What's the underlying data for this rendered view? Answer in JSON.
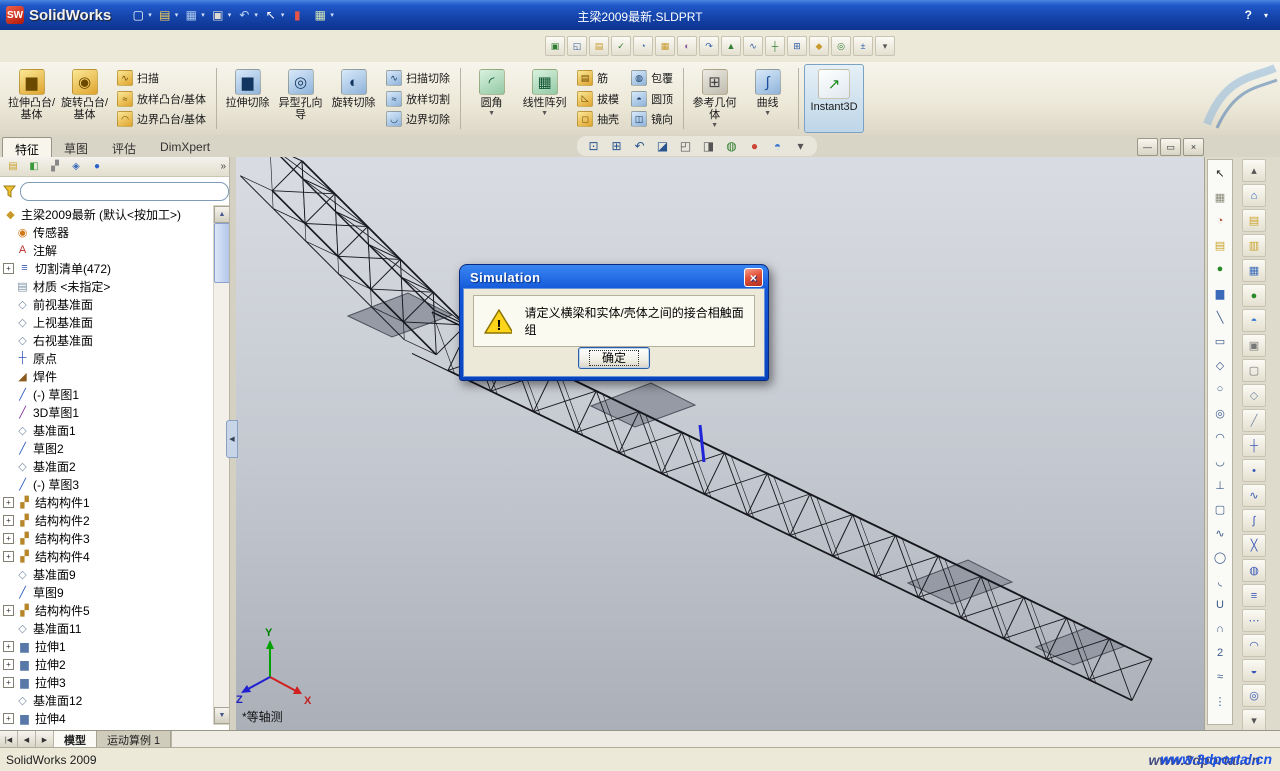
{
  "titlebar": {
    "app": "SolidWorks",
    "doc": "主梁2009最新.SLDPRT",
    "help": "?",
    "tools": [
      {
        "name": "new-document-icon",
        "caret": true
      },
      {
        "name": "open-document-icon",
        "caret": true
      },
      {
        "name": "save-icon",
        "caret": true
      },
      {
        "name": "print-icon",
        "caret": true
      },
      {
        "name": "undo-icon",
        "caret": true
      },
      {
        "name": "select-icon",
        "caret": true
      },
      {
        "name": "record-macro-icon",
        "caret": false
      },
      {
        "name": "options-icon",
        "caret": true
      }
    ]
  },
  "toolbar2": {
    "icons": [
      "screen-capture-icon",
      "3d-drawing-view-icon",
      "publish-edrawings-icon",
      "design-checker-icon",
      "task-scheduler-icon",
      "toolbox-icon",
      "photoworks-icon",
      "motion-manager-icon",
      "simulation-addin-icon",
      "flow-simulation-icon",
      "routing-icon",
      "circuitworks-icon",
      "featureworks-icon",
      "scanto3d-icon",
      "tolanalyst-icon",
      "addins-settings-icon"
    ]
  },
  "ribbon": {
    "buttons": [
      {
        "type": "big",
        "icon": "extrude-boss-icon",
        "label": "拉伸凸台/基体"
      },
      {
        "type": "big",
        "icon": "revolve-boss-icon",
        "label": "旋转凸台/基体"
      },
      {
        "type": "stack",
        "items": [
          {
            "icon": "sweep-icon",
            "label": "扫描"
          },
          {
            "icon": "loft-icon",
            "label": "放样凸台/基体"
          },
          {
            "icon": "boundary-boss-icon",
            "label": "边界凸台/基体"
          }
        ]
      },
      {
        "type": "sep"
      },
      {
        "type": "big",
        "icon": "extrude-cut-icon",
        "label": "拉伸切除"
      },
      {
        "type": "big",
        "icon": "hole-wizard-icon",
        "label": "异型孔向导"
      },
      {
        "type": "big",
        "icon": "revolve-cut-icon",
        "label": "旋转切除"
      },
      {
        "type": "stack",
        "items": [
          {
            "icon": "sweep-cut-icon",
            "label": "扫描切除"
          },
          {
            "icon": "loft-cut-icon",
            "label": "放样切割"
          },
          {
            "icon": "boundary-cut-icon",
            "label": "边界切除"
          }
        ]
      },
      {
        "type": "sep"
      },
      {
        "type": "big",
        "icon": "fillet-icon",
        "label": "圆角",
        "dropdown": true
      },
      {
        "type": "big",
        "icon": "linear-pattern-icon",
        "label": "线性阵列",
        "dropdown": true
      },
      {
        "type": "stack",
        "items": [
          {
            "icon": "rib-icon",
            "label": "筋"
          },
          {
            "icon": "draft-icon",
            "label": "拔模"
          },
          {
            "icon": "shell-icon",
            "label": "抽壳"
          }
        ]
      },
      {
        "type": "stack",
        "items": [
          {
            "icon": "wrap-icon",
            "label": "包覆"
          },
          {
            "icon": "dome-icon",
            "label": "圆顶"
          },
          {
            "icon": "mirror-icon",
            "label": "镜向"
          }
        ]
      },
      {
        "type": "sep"
      },
      {
        "type": "big",
        "icon": "reference-geometry-icon",
        "label": "参考几何体",
        "dropdown": true
      },
      {
        "type": "big",
        "icon": "curves-icon",
        "label": "曲线",
        "dropdown": true
      },
      {
        "type": "sep"
      },
      {
        "type": "big-wide",
        "icon": "instant3d-icon",
        "label": "Instant3D",
        "active": true
      }
    ]
  },
  "mode_tabs": [
    {
      "label": "特征",
      "active": true
    },
    {
      "label": "草图",
      "active": false
    },
    {
      "label": "评估",
      "active": false
    },
    {
      "label": "DimXpert",
      "active": false
    }
  ],
  "headsup": {
    "icons": [
      "zoom-to-fit-icon",
      "zoom-to-area-icon",
      "previous-view-icon",
      "section-view-icon",
      "view-orientation-icon",
      "display-style-icon",
      "hide-show-items-icon",
      "edit-appearance-icon",
      "apply-scene-icon",
      "view-settings-icon"
    ]
  },
  "window_buttons": [
    "minimize-icon",
    "restore-icon",
    "close-icon"
  ],
  "left_panel": {
    "tabs": [
      "featuremanager-tab-icon",
      "propertymanager-tab-icon",
      "configurationmanager-tab-icon",
      "dimxpertmanager-tab-icon",
      "displaymanager-tab-icon"
    ],
    "chevron": "»",
    "filter": {
      "placeholder": ""
    },
    "tree": {
      "root": {
        "label": "主梁2009最新 (默认<按加工>)",
        "icon": "part-icon"
      },
      "items": [
        {
          "label": "传感器",
          "icon": "sensors-folder-icon"
        },
        {
          "label": "注解",
          "icon": "annotations-icon"
        },
        {
          "label": "切割清单(472)",
          "icon": "cutlist-icon",
          "expand": "+"
        },
        {
          "label": "材质 <未指定>",
          "icon": "material-icon"
        },
        {
          "label": "前视基准面",
          "icon": "plane-icon"
        },
        {
          "label": "上视基准面",
          "icon": "plane-icon"
        },
        {
          "label": "右视基准面",
          "icon": "plane-icon"
        },
        {
          "label": "原点",
          "icon": "origin-icon"
        },
        {
          "label": "焊件",
          "icon": "weldment-icon"
        },
        {
          "label": "(-) 草图1",
          "icon": "sketch-icon"
        },
        {
          "label": "3D草图1",
          "icon": "sketch3d-icon"
        },
        {
          "label": "基准面1",
          "icon": "plane-icon"
        },
        {
          "label": "草图2",
          "icon": "sketch-icon"
        },
        {
          "label": "基准面2",
          "icon": "plane-icon"
        },
        {
          "label": "(-) 草图3",
          "icon": "sketch-icon"
        },
        {
          "label": "结构构件1",
          "icon": "structural-member-icon",
          "expand": "+"
        },
        {
          "label": "结构构件2",
          "icon": "structural-member-icon",
          "expand": "+"
        },
        {
          "label": "结构构件3",
          "icon": "structural-member-icon",
          "expand": "+"
        },
        {
          "label": "结构构件4",
          "icon": "structural-member-icon",
          "expand": "+"
        },
        {
          "label": "基准面9",
          "icon": "plane-icon"
        },
        {
          "label": "草图9",
          "icon": "sketch-icon"
        },
        {
          "label": "结构构件5",
          "icon": "structural-member-icon",
          "expand": "+"
        },
        {
          "label": "基准面11",
          "icon": "plane-icon"
        },
        {
          "label": "拉伸1",
          "icon": "extrude-icon",
          "expand": "+"
        },
        {
          "label": "拉伸2",
          "icon": "extrude-icon",
          "expand": "+"
        },
        {
          "label": "拉伸3",
          "icon": "extrude-icon",
          "expand": "+"
        },
        {
          "label": "基准面12",
          "icon": "plane-icon"
        },
        {
          "label": "拉伸4",
          "icon": "extrude-icon",
          "expand": "+"
        }
      ]
    }
  },
  "viewport": {
    "view_label": "*等轴测",
    "triad": {
      "x": "X",
      "y": "Y",
      "z": "Z"
    }
  },
  "dialog": {
    "title": "Simulation",
    "message": "请定义横梁和实体/壳体之间的接合相触面组",
    "ok_label": "确定"
  },
  "rightbar": {
    "colA": [
      "select-cursor-icon",
      "grid-system-icon",
      "evaluate-icon",
      "folder-icon",
      "sphere-icon",
      "chart-icon",
      "line-icon",
      "rectangle-icon",
      "diamond-icon",
      "circle-icon",
      "concentric-icon",
      "arc-icon",
      "three-point-arc-icon",
      "perpendicular-icon",
      "slot-icon",
      "spline-icon",
      "ellipse-icon",
      "parabola-icon",
      "u-curve-icon",
      "n-curve-icon",
      "numeric-curve-icon",
      "wave-icon",
      "dots-icon"
    ],
    "colB": [
      "up-arrow-icon",
      "home-icon",
      "design-library-icon",
      "file-explorer-icon",
      "view-palette-icon",
      "appearances-icon",
      "scenes-icon",
      "custom-properties-icon",
      "document-icon",
      "plane2-icon",
      "axis-icon",
      "coordinate-icon",
      "point2-icon",
      "helix-icon",
      "curve-icon",
      "split-icon",
      "project-icon",
      "composite-icon",
      "through-points-icon",
      "freeform-icon",
      "deform-icon",
      "flex-icon",
      "down-arrow-icon"
    ]
  },
  "bottom": {
    "nav": [
      "first-tab-icon",
      "prev-tab-icon",
      "next-tab-icon"
    ],
    "tabs": [
      {
        "label": "模型",
        "active": true
      },
      {
        "label": "运动算例 1",
        "active": false
      }
    ]
  },
  "statusbar": {
    "left": "SolidWorks 2009",
    "watermark": "www.3dportal.cn"
  }
}
